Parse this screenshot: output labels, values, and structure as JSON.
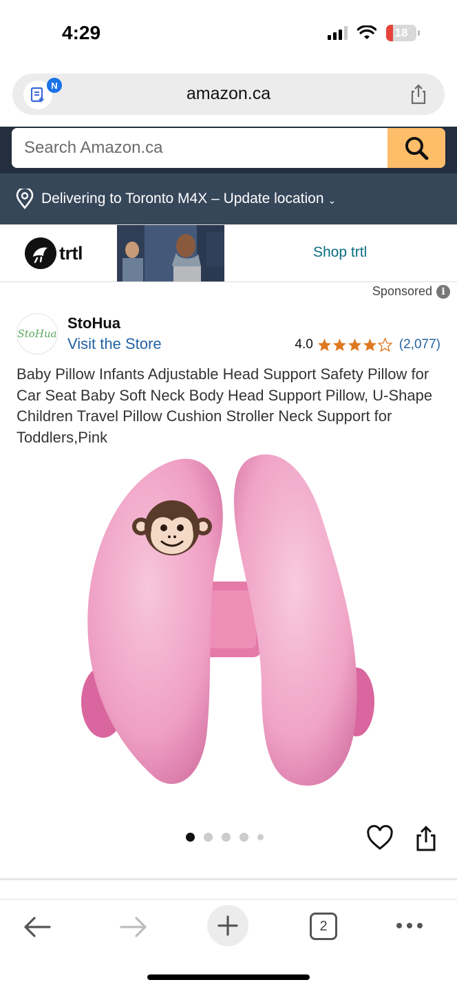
{
  "status_bar": {
    "time": "4:29",
    "battery": "18"
  },
  "browser": {
    "url": "amazon.ca",
    "reader_badge": "N",
    "tab_count": "2"
  },
  "amazon": {
    "search_placeholder": "Search Amazon.ca",
    "delivery_text": "Delivering to Toronto M4X – Update location"
  },
  "ad": {
    "brand": "trtl",
    "cta": "Shop trtl",
    "sponsored_label": "Sponsored"
  },
  "store": {
    "logo_text": "StoHua",
    "name": "StoHua",
    "link": "Visit the Store"
  },
  "rating": {
    "value": "4.0",
    "stars": 4,
    "count": "(2,077)"
  },
  "product": {
    "title": "Baby Pillow Infants Adjustable Head Support Safety Pillow for Car Seat Baby Soft Neck Body Head Support Pillow, U-Shape Children Travel Pillow Cushion Stroller Neck Support for Toddlers,Pink",
    "image_count": 5,
    "active_image": 1
  },
  "colors": {
    "amazon_dark": "#232f3e",
    "amazon_nav": "#37475a",
    "search_button": "#febd69",
    "link_blue": "#2162a1",
    "star_orange": "#de7921",
    "pillow_pink": "#f0a8cc"
  },
  "icons": {
    "reader": "reader-mode-icon",
    "share": "share-icon",
    "search": "search-icon",
    "location": "location-pin-icon",
    "wishlist": "heart-icon",
    "back": "back-arrow-icon",
    "forward": "forward-arrow-icon",
    "new_tab": "plus-icon",
    "more": "more-icon"
  }
}
